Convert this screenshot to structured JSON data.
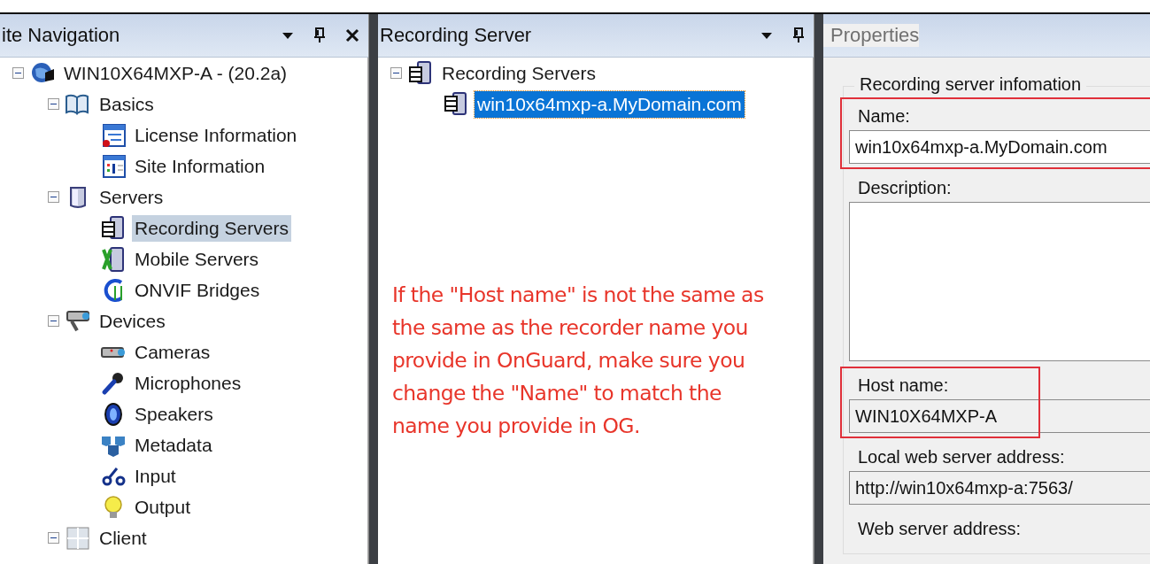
{
  "site_navigation": {
    "title": "ite Navigation",
    "tree": [
      {
        "label": "WIN10X64MXP-A - (20.2a)",
        "kind": "site",
        "expanded": true,
        "selected": false,
        "children": [
          {
            "label": "Basics",
            "kind": "book",
            "expanded": true,
            "selected": false,
            "children": [
              {
                "label": "License Information",
                "kind": "license",
                "selected": false
              },
              {
                "label": "Site Information",
                "kind": "info",
                "selected": false
              }
            ]
          },
          {
            "label": "Servers",
            "kind": "server",
            "expanded": true,
            "selected": false,
            "children": [
              {
                "label": "Recording Servers",
                "kind": "recorder",
                "selected": true
              },
              {
                "label": "Mobile Servers",
                "kind": "mobile",
                "selected": false
              },
              {
                "label": "ONVIF Bridges",
                "kind": "onvif",
                "selected": false
              }
            ]
          },
          {
            "label": "Devices",
            "kind": "devices",
            "expanded": true,
            "selected": false,
            "children": [
              {
                "label": "Cameras",
                "kind": "camera",
                "selected": false
              },
              {
                "label": "Microphones",
                "kind": "mic",
                "selected": false
              },
              {
                "label": "Speakers",
                "kind": "speaker",
                "selected": false
              },
              {
                "label": "Metadata",
                "kind": "metadata",
                "selected": false
              },
              {
                "label": "Input",
                "kind": "input",
                "selected": false
              },
              {
                "label": "Output",
                "kind": "bulb",
                "selected": false
              }
            ]
          },
          {
            "label": "Client",
            "kind": "grid",
            "expanded": true,
            "selected": false
          }
        ]
      }
    ]
  },
  "recording_server": {
    "title": "Recording Server",
    "tree": [
      {
        "label": "Recording Servers",
        "kind": "recorder",
        "expanded": true,
        "selected": false,
        "children": [
          {
            "label": "win10x64mxp-a.MyDomain.com",
            "kind": "recorder-single",
            "selected": true
          }
        ]
      }
    ],
    "note": [
      "If the \"Host name\" is not the same as",
      "the same as the recorder name you",
      "provide in OnGuard, make sure you",
      "change the \"Name\" to match the",
      "name you provide in OG."
    ]
  },
  "properties": {
    "title": "Properties",
    "group_title": "Recording server infomation",
    "fields": [
      {
        "label": "Name:",
        "kind": "text",
        "value": "win10x64mxp-a.MyDomain.com",
        "readonly": false,
        "highlighted": true
      },
      {
        "label": "Description:",
        "kind": "textarea",
        "readonly": false,
        "highlighted": false
      },
      {
        "label": "Host name:",
        "kind": "text",
        "value": "WIN10X64MXP-A",
        "readonly": true,
        "highlighted": true
      },
      {
        "label": "Local web server address:",
        "kind": "text",
        "value": "http://win10x64mxp-a:7563/",
        "readonly": true,
        "highlighted": false
      },
      {
        "label": "Web server address:",
        "kind": "label"
      }
    ]
  }
}
